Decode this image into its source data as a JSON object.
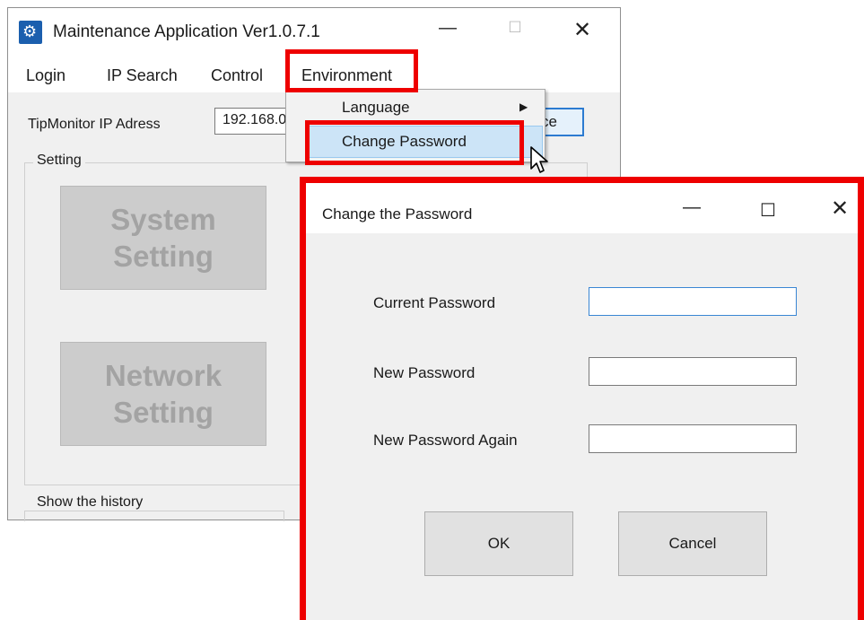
{
  "main_window": {
    "title": "Maintenance Application Ver1.0.7.1",
    "controls": {
      "minimize": "—",
      "maximize": "☐",
      "close": "✕"
    }
  },
  "menu": [
    "Login",
    "IP Search",
    "Control",
    "Environment"
  ],
  "dropdown": {
    "items": [
      "Language",
      "Change Password"
    ],
    "submenu_arrow": "▶"
  },
  "connection": {
    "label": "TipMonitor IP Adress",
    "ip_value": "192.168.0",
    "connect_label_fragment": "ce"
  },
  "setting_group": {
    "legend": "Setting",
    "system_button": "System Setting",
    "network_button": "Network Setting"
  },
  "history_group": {
    "legend": "Show the history"
  },
  "dialog": {
    "title": "Change the Password",
    "controls": {
      "minimize": "—",
      "maximize": "☐",
      "close": "✕"
    },
    "labels": [
      "Current Password",
      "New Password",
      "New Password Again"
    ],
    "values": [
      "",
      "",
      ""
    ],
    "ok_label": "OK",
    "cancel_label": "Cancel"
  },
  "colors": {
    "highlight_red": "#ee0000",
    "focus_blue": "#2c7bd1",
    "menu_highlight": "#cce4f7"
  },
  "icons": [
    "app-icon",
    "submenu-arrow-icon",
    "mouse-cursor-icon"
  ]
}
